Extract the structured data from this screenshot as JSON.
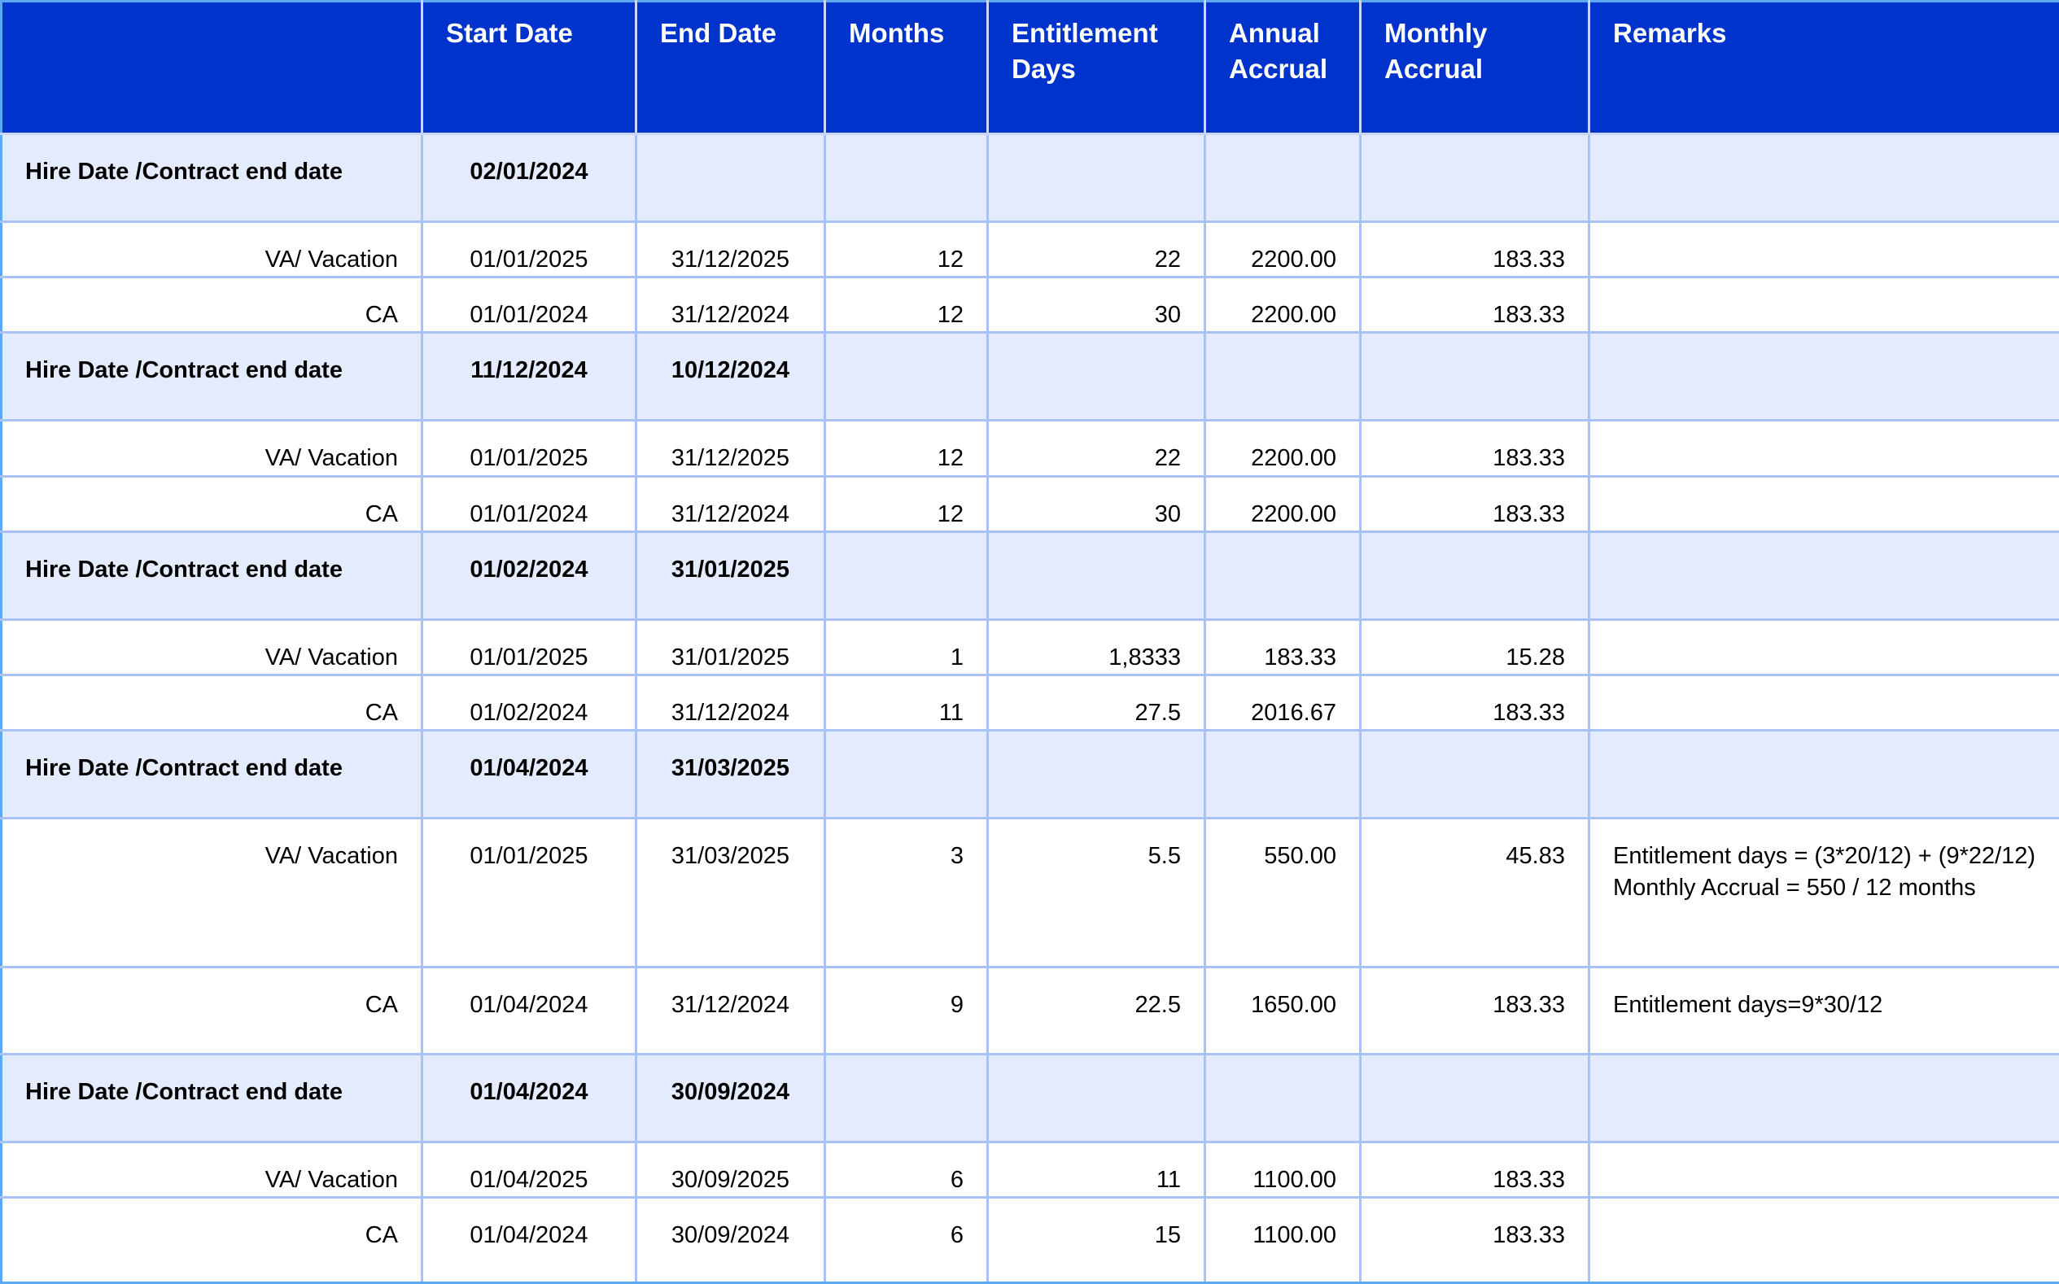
{
  "headers": {
    "col0": "",
    "start_date": "Start Date",
    "end_date": "End Date",
    "months": "Months",
    "entitlement_days": "Entitlement Days",
    "annual_accrual": "Annual Accrual",
    "monthly_accrual": "Monthly Accrual",
    "remarks": "Remarks"
  },
  "groups": [
    {
      "label": "Hire Date /Contract end date",
      "start": "02/01/2024",
      "end": "",
      "items": [
        {
          "type": "VA/ Vacation",
          "start": "01/01/2025",
          "end": "31/12/2025",
          "months": "12",
          "days": "22",
          "annual": "2200.00",
          "monthly": "183.33",
          "remarks": ""
        },
        {
          "type": "CA",
          "start": "01/01/2024",
          "end": "31/12/2024",
          "months": "12",
          "days": "30",
          "annual": "2200.00",
          "monthly": "183.33",
          "remarks": ""
        }
      ]
    },
    {
      "label": "Hire Date /Contract end date",
      "start": "11/12/2024",
      "end": "10/12/2024",
      "items": [
        {
          "type": "VA/ Vacation",
          "start": "01/01/2025",
          "end": "31/12/2025",
          "months": "12",
          "days": "22",
          "annual": "2200.00",
          "monthly": "183.33",
          "remarks": ""
        },
        {
          "type": "CA",
          "start": "01/01/2024",
          "end": "31/12/2024",
          "months": "12",
          "days": "30",
          "annual": "2200.00",
          "monthly": "183.33",
          "remarks": ""
        }
      ]
    },
    {
      "label": "Hire Date /Contract end date",
      "start": "01/02/2024",
      "end": "31/01/2025",
      "items": [
        {
          "type": "VA/ Vacation",
          "start": "01/01/2025",
          "end": "31/01/2025",
          "months": "1",
          "days": "1,8333",
          "annual": "183.33",
          "monthly": "15.28",
          "remarks": ""
        },
        {
          "type": "CA",
          "start": "01/02/2024",
          "end": "31/12/2024",
          "months": "11",
          "days": "27.5",
          "annual": "2016.67",
          "monthly": "183.33",
          "remarks": ""
        }
      ]
    },
    {
      "label": "Hire Date /Contract end date",
      "start": "01/04/2024",
      "end": "31/03/2025",
      "items": [
        {
          "type": "VA/ Vacation",
          "start": "01/01/2025",
          "end": "31/03/2025",
          "months": "3",
          "days": "5.5",
          "annual": "550.00",
          "monthly": "45.83",
          "remarks": "Entitlement days  = (3*20/12) + (9*22/12)\nMonthly Accrual = 550 / 12 months"
        },
        {
          "type": "CA",
          "start": "01/04/2024",
          "end": "31/12/2024",
          "months": "9",
          "days": "22.5",
          "annual": "1650.00",
          "monthly": "183.33",
          "remarks": "Entitlement days=9*30/12"
        }
      ]
    },
    {
      "label": "Hire Date /Contract end date",
      "start": "01/04/2024",
      "end": "30/09/2024",
      "items": [
        {
          "type": "VA/ Vacation",
          "start": "01/04/2025",
          "end": "30/09/2025",
          "months": "6",
          "days": "11",
          "annual": "1100.00",
          "monthly": "183.33",
          "remarks": ""
        },
        {
          "type": "CA",
          "start": "01/04/2024",
          "end": "30/09/2024",
          "months": "6",
          "days": "15",
          "annual": "1100.00",
          "monthly": "183.33",
          "remarks": ""
        }
      ]
    }
  ]
}
